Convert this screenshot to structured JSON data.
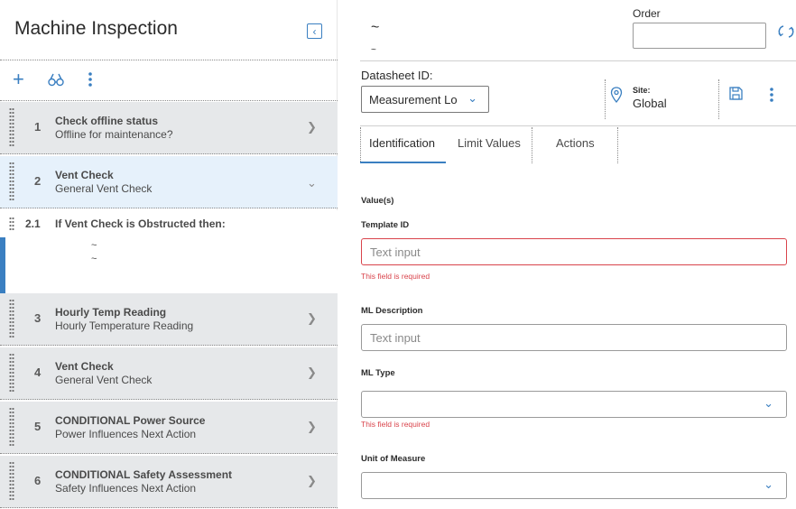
{
  "left": {
    "title": "Machine Inspection",
    "steps_top": [
      {
        "num": "1",
        "title": "Check offline status",
        "sub": "Offline for maintenance?"
      },
      {
        "num": "2",
        "title": "Vent Check",
        "sub": "General Vent Check"
      }
    ],
    "substep": {
      "num": "2.1",
      "title": "If Vent Check is Obstructed then:",
      "line1": "~",
      "line2": "~"
    },
    "steps_bottom": [
      {
        "num": "3",
        "title": "Hourly Temp Reading",
        "sub": "Hourly Temperature Reading"
      },
      {
        "num": "4",
        "title": "Vent Check",
        "sub": "General Vent Check"
      },
      {
        "num": "5",
        "title": "CONDITIONAL Power Source",
        "sub": "Power Influences Next Action"
      },
      {
        "num": "6",
        "title": "CONDITIONAL Safety Assessment",
        "sub": "Safety Influences Next Action"
      }
    ]
  },
  "header": {
    "tilde_main": "~",
    "tilde_sub": "~",
    "order_label": "Order",
    "order_value": ""
  },
  "datasheet": {
    "label": "Datasheet ID:",
    "value": "Measurement Lo",
    "site_label": "Site:",
    "site_value": "Global"
  },
  "tabs": [
    "Identification",
    "Limit Values",
    "Actions"
  ],
  "form": {
    "values_label": "Value(s)",
    "template_id_label": "Template ID",
    "template_id_placeholder": "Text input",
    "required_msg": "This field is required",
    "ml_description_label": "ML Description",
    "ml_description_placeholder": "Text input",
    "ml_type_label": "ML Type",
    "unit_label": "Unit of Measure"
  },
  "colors": {
    "accent": "#3a7fc1",
    "error": "#d9434b",
    "selected_row": "#e6f1fb",
    "row": "#e6e8ea"
  }
}
